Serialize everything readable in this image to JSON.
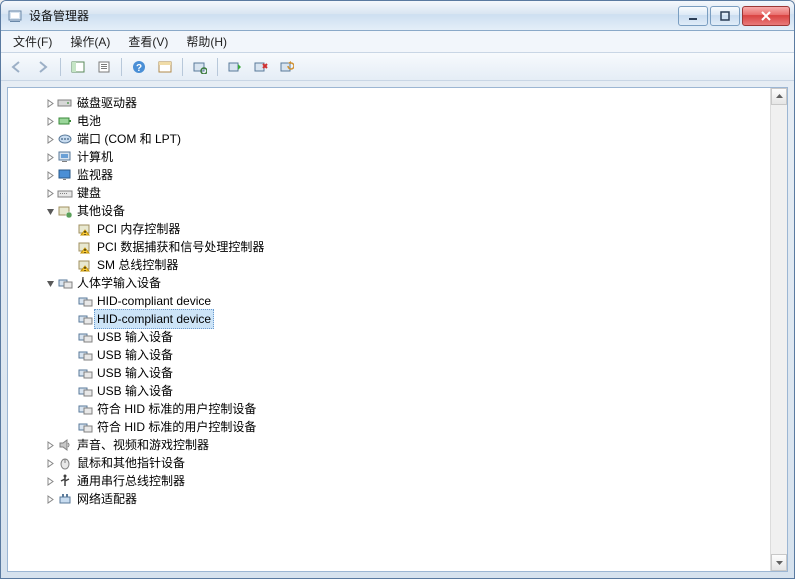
{
  "window": {
    "title": "设备管理器"
  },
  "menu": {
    "file": "文件(F)",
    "action": "操作(A)",
    "view": "查看(V)",
    "help": "帮助(H)"
  },
  "toolbar": {
    "back": "后退",
    "forward": "前进",
    "show_hide": "显示/隐藏控制台树",
    "properties": "属性",
    "help": "帮助",
    "details": "切换",
    "scan": "扫描检测硬件改动",
    "add": "添加",
    "uninstall": "卸载",
    "update": "更新驱动程序"
  },
  "tree": {
    "disk_drives": "磁盘驱动器",
    "batteries": "电池",
    "ports": "端口 (COM 和 LPT)",
    "computer": "计算机",
    "monitors": "监视器",
    "keyboards": "键盘",
    "other_devices": {
      "label": "其他设备",
      "items": [
        "PCI 内存控制器",
        "PCI 数据捕获和信号处理控制器",
        "SM 总线控制器"
      ]
    },
    "hid": {
      "label": "人体学输入设备",
      "items": [
        "HID-compliant device",
        "HID-compliant device",
        "USB 输入设备",
        "USB 输入设备",
        "USB 输入设备",
        "USB 输入设备",
        "符合 HID 标准的用户控制设备",
        "符合 HID 标准的用户控制设备"
      ],
      "selected_index": 1
    },
    "sound": "声音、视频和游戏控制器",
    "mice": "鼠标和其他指针设备",
    "usb_controllers": "通用串行总线控制器",
    "network": "网络适配器"
  }
}
